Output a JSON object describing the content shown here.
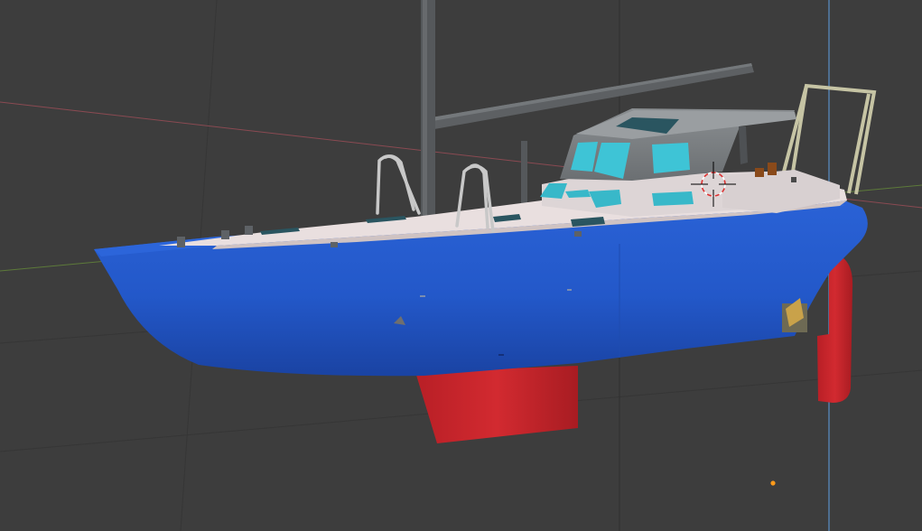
{
  "app": {
    "window": "3D Viewport",
    "scene_object": "sailboat-model"
  },
  "colors": {
    "background": "#3d3d3d",
    "grid_line": "#363636",
    "x_axis": "#8a4a52",
    "y_axis": "#5d7a3a",
    "z_axis": "#5b8fc9",
    "hull": "#2358c9",
    "hull_dark": "#1a43a3",
    "deck": "#e8dede",
    "cabin": "#7b7f82",
    "window": "#3ec4d6",
    "keel": "#c4242a",
    "mast": "#5a5d60",
    "rail": "#c8c8b8",
    "origin": "#ff9a1a"
  },
  "icons": {
    "cursor": "3d-cursor-icon",
    "origin": "object-origin-icon"
  }
}
